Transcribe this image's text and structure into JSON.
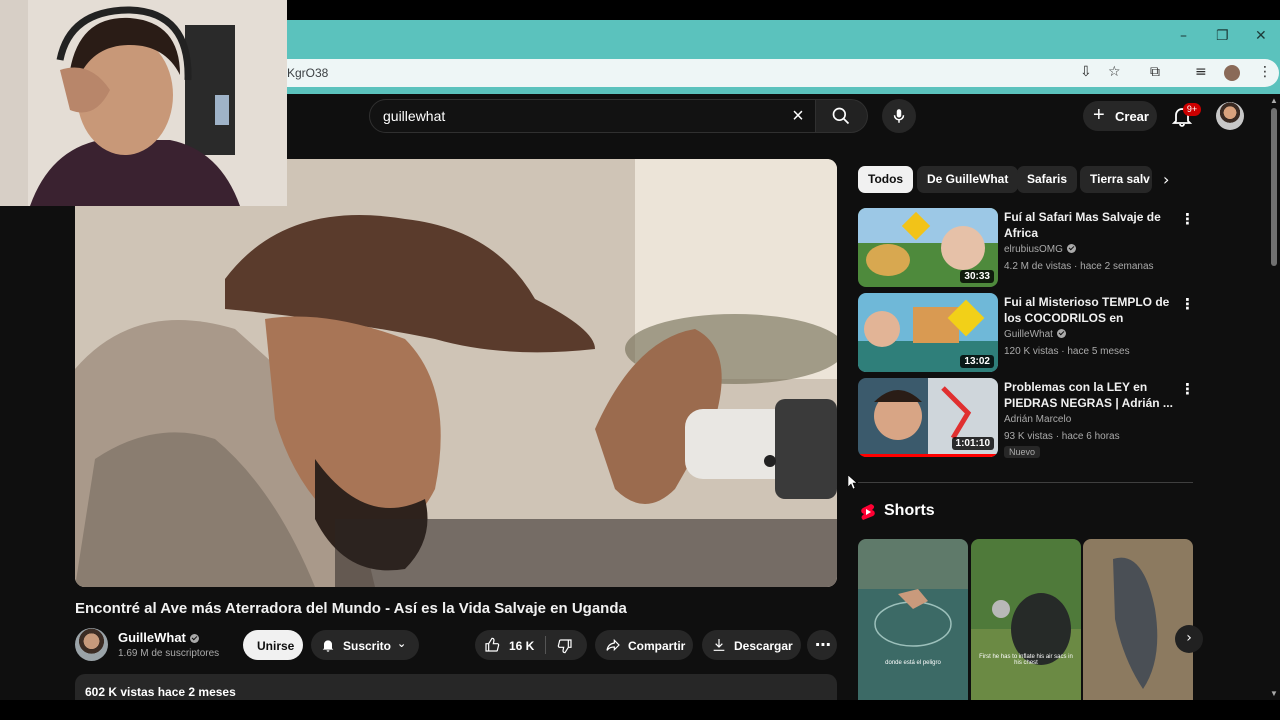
{
  "browser": {
    "url_fragment": "KgrO38",
    "window_controls": {
      "minimize": "–",
      "restore": "❐",
      "close": "✕"
    }
  },
  "header": {
    "search_query": "guillewhat",
    "create_label": "Crear",
    "notifications_badge": "9+"
  },
  "video": {
    "title": "Encontré al Ave más Aterradora del Mundo - Así es la Vida Salvaje en Uganda",
    "channel_name": "GuilleWhat",
    "subscribers": "1.69 M de suscriptores",
    "join_label": "Unirse",
    "subscribed_label": "Suscrito",
    "likes": "16 K",
    "share_label": "Compartir",
    "download_label": "Descargar",
    "description_meta": "602 K vistas  hace 2 meses"
  },
  "chips": [
    {
      "label": "Todos",
      "active": true
    },
    {
      "label": "De GuilleWhat",
      "active": false
    },
    {
      "label": "Safaris",
      "active": false
    },
    {
      "label": "Tierra salv",
      "active": false
    }
  ],
  "recommendations": [
    {
      "title": "Fuí al Safari Mas Salvaje de Africa",
      "channel": "elrubiusOMG",
      "stats": "4.2 M de vistas · hace 2 semanas",
      "duration": "30:33",
      "new": ""
    },
    {
      "title": "Fui al Misterioso TEMPLO de los COCODRILOS en Pakistán ...",
      "channel": "GuilleWhat",
      "stats": "120 K vistas · hace 5 meses",
      "duration": "13:02",
      "new": ""
    },
    {
      "title": "Problemas con la LEY en PIEDRAS NEGRAS | Adrián ...",
      "channel": "Adrián Marcelo",
      "stats": "93 K vistas · hace 6 horas",
      "duration": "1:01:10",
      "new": "Nuevo"
    }
  ],
  "shorts": {
    "title": "Shorts",
    "items": [
      {
        "caption": "donde está el peligro"
      },
      {
        "caption": "First he has to inflate his air sacs in his chest"
      },
      {
        "caption": ""
      }
    ]
  },
  "colors": {
    "chrome_teal": "#5bc2bd",
    "yt_background": "#0f0f0f",
    "chip_active": "#f1f1f1",
    "progress_red": "#ff0000",
    "badge_red": "#cc0000"
  }
}
